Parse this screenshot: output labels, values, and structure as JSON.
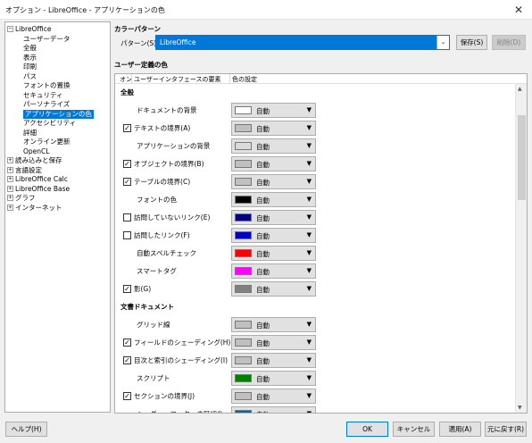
{
  "window": {
    "title": "オプション - LibreOffice - アプリケーションの色",
    "close_icon": "✕"
  },
  "tree": {
    "items": [
      {
        "label": "LibreOffice",
        "expander": "−",
        "level": 0
      },
      {
        "label": "ユーザーデータ",
        "level": 1
      },
      {
        "label": "全般",
        "level": 1
      },
      {
        "label": "表示",
        "level": 1
      },
      {
        "label": "印刷",
        "level": 1
      },
      {
        "label": "パス",
        "level": 1
      },
      {
        "label": "フォントの置換",
        "level": 1
      },
      {
        "label": "セキュリティ",
        "level": 1
      },
      {
        "label": "パーソナライズ",
        "level": 1
      },
      {
        "label": "アプリケーションの色",
        "level": 1,
        "selected": true
      },
      {
        "label": "アクセシビリティ",
        "level": 1
      },
      {
        "label": "詳細",
        "level": 1
      },
      {
        "label": "オンライン更新",
        "level": 1
      },
      {
        "label": "OpenCL",
        "level": 1
      },
      {
        "label": "読み込みと保存",
        "expander": "+",
        "level": 0
      },
      {
        "label": "言語設定",
        "expander": "+",
        "level": 0
      },
      {
        "label": "LibreOffice Calc",
        "expander": "+",
        "level": 0
      },
      {
        "label": "LibreOffice Base",
        "expander": "+",
        "level": 0
      },
      {
        "label": "グラフ",
        "expander": "+",
        "level": 0
      },
      {
        "label": "インターネット",
        "expander": "+",
        "level": 0
      }
    ]
  },
  "scheme": {
    "section_title": "カラーパターン",
    "label": "パターン(S):",
    "value": "LibreOffice",
    "save_label": "保存(S)",
    "delete_label": "削除(D)"
  },
  "custom": {
    "section_title": "ユーザー定義の色",
    "col_on": "オン",
    "col_element": "ユーザーインタフェースの要素",
    "col_color": "色の設定"
  },
  "rows": [
    {
      "type": "header",
      "label": "全般"
    },
    {
      "label": "ドキュメントの背景",
      "checkbox": false,
      "color": "#ffffff",
      "color_label": "自動"
    },
    {
      "label": "テキストの境界(A)",
      "checkbox": true,
      "checked": true,
      "color": "#c0c0c0",
      "color_label": "自動"
    },
    {
      "label": "アプリケーションの背景",
      "checkbox": false,
      "color": "#dadada",
      "color_label": "自動"
    },
    {
      "label": "オブジェクトの境界(B)",
      "checkbox": true,
      "checked": true,
      "color": "#c0c0c0",
      "color_label": "自動"
    },
    {
      "label": "テーブルの境界(C)",
      "checkbox": true,
      "checked": true,
      "color": "#c0c0c0",
      "color_label": "自動"
    },
    {
      "label": "フォントの色",
      "checkbox": false,
      "color": "#000000",
      "color_label": "自動"
    },
    {
      "label": "訪問していないリンク(E)",
      "checkbox": true,
      "checked": false,
      "color": "#000080",
      "color_label": "自動"
    },
    {
      "label": "訪問したリンク(F)",
      "checkbox": true,
      "checked": false,
      "color": "#0000c0",
      "color_label": "自動"
    },
    {
      "label": "自動スペルチェック",
      "checkbox": false,
      "color": "#ff0000",
      "color_label": "自動"
    },
    {
      "label": "スマートタグ",
      "checkbox": false,
      "color": "#ff00ff",
      "color_label": "自動"
    },
    {
      "label": "影(G)",
      "checkbox": true,
      "checked": true,
      "color": "#808080",
      "color_label": "自動"
    },
    {
      "type": "header",
      "label": "文書ドキュメント"
    },
    {
      "label": "グリッド線",
      "checkbox": false,
      "color": "#c0c0c0",
      "color_label": "自動"
    },
    {
      "label": "フィールドのシェーディング(H)",
      "checkbox": true,
      "checked": true,
      "color": "#c0c0c0",
      "color_label": "自動"
    },
    {
      "label": "目次と索引のシェーディング(I)",
      "checkbox": true,
      "checked": true,
      "color": "#c0c0c0",
      "color_label": "自動"
    },
    {
      "label": "スクリプト",
      "checkbox": false,
      "color": "#008000",
      "color_label": "自動"
    },
    {
      "label": "セクションの境界(J)",
      "checkbox": true,
      "checked": true,
      "color": "#c0c0c0",
      "color_label": "自動"
    },
    {
      "label": "ヘッダー、フッターの区切り",
      "checkbox": false,
      "color": "#0369a3",
      "color_label": "自動"
    }
  ],
  "footer": {
    "help_label": "ヘルプ(H)",
    "ok_label": "OK",
    "cancel_label": "キャンセル",
    "apply_label": "適用(A)",
    "reset_label": "元に戻す(R)"
  }
}
